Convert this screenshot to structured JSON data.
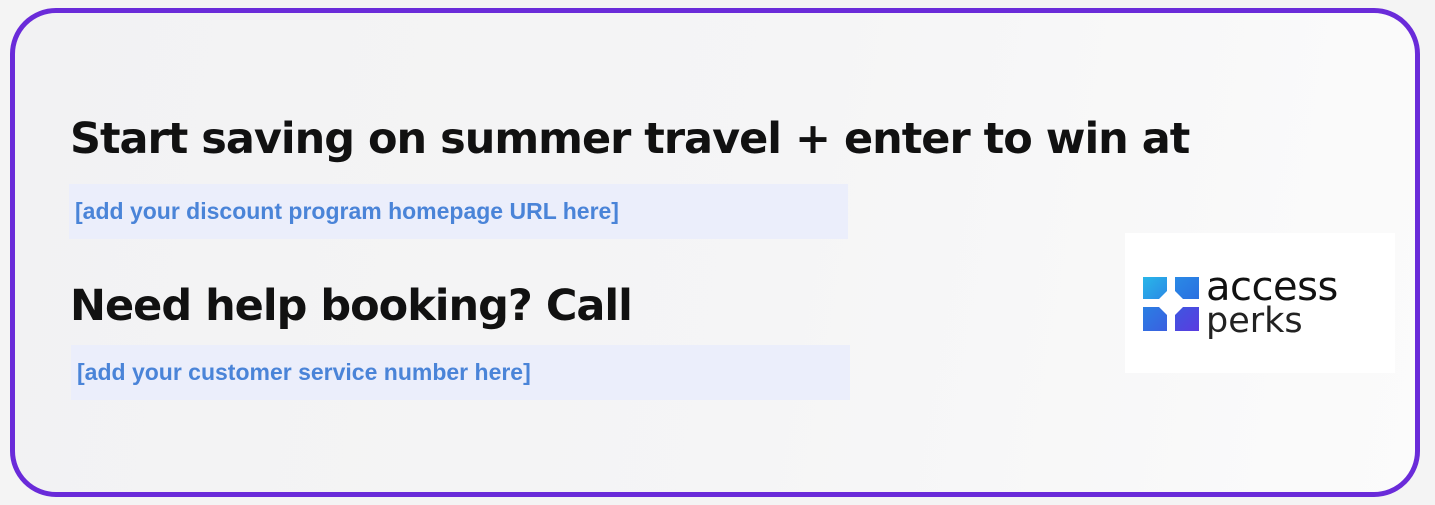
{
  "promo": {
    "headline_travel": "Start saving on summer travel + enter to win at",
    "url_placeholder": "[add your discount program homepage URL here]",
    "headline_help": "Need help booking? Call",
    "phone_placeholder": "[add your customer service number here]"
  },
  "logo": {
    "word1": "access",
    "word2": "perks",
    "icon": "access-perks-logo-icon"
  },
  "colors": {
    "border": "#6a2bd9",
    "placeholder_text": "#4a84d8",
    "placeholder_bg": "#ebeefb",
    "logo_cyan": "#29b6e8",
    "logo_blue": "#2a6fe0",
    "logo_purple": "#5b3be0"
  }
}
